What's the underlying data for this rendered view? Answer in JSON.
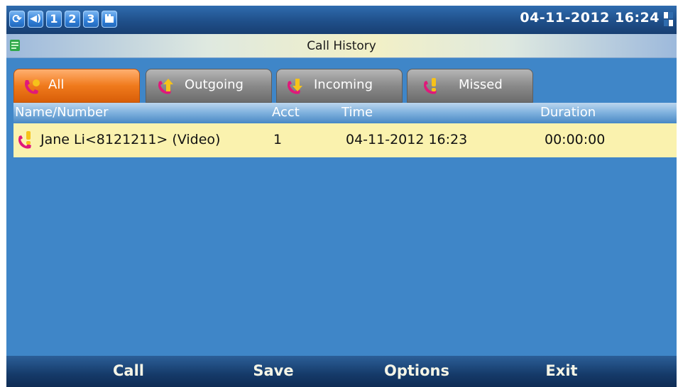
{
  "status_bar": {
    "icons": [
      {
        "name": "sync-icon",
        "glyph": "⟳"
      },
      {
        "name": "volume-icon",
        "glyph": "◀"
      },
      {
        "name": "account-1-icon",
        "glyph": "1"
      },
      {
        "name": "account-2-icon",
        "glyph": "2"
      },
      {
        "name": "account-3-icon",
        "glyph": "3"
      },
      {
        "name": "network-icon",
        "glyph": "▟"
      }
    ],
    "datetime": "04-11-2012 16:24"
  },
  "title_bar": {
    "title": "Call History"
  },
  "tabs": [
    {
      "label": "All",
      "icon": "all-calls-icon",
      "active": true
    },
    {
      "label": "Outgoing",
      "icon": "outgoing-call-icon",
      "active": false
    },
    {
      "label": "Incoming",
      "icon": "incoming-call-icon",
      "active": false
    },
    {
      "label": "Missed",
      "icon": "missed-call-icon",
      "active": false
    }
  ],
  "columns": {
    "name_number": "Name/Number",
    "acct": "Acct",
    "time": "Time",
    "duration": "Duration"
  },
  "rows": [
    {
      "type_icon": "missed-call-icon",
      "name_number": "Jane Li<8121211> (Video)",
      "acct": "1",
      "time": "04-11-2012 16:23",
      "duration": "00:00:00"
    }
  ],
  "softkeys": {
    "call": "Call",
    "save": "Save",
    "options": "Options",
    "exit": "Exit"
  },
  "colors": {
    "screen_bg": "#3f86c8",
    "active_tab": "#f07a1c",
    "selected_row": "#faf2ae",
    "phone_icon": "#e0197a",
    "arrow_icon": "#f6c21a"
  }
}
